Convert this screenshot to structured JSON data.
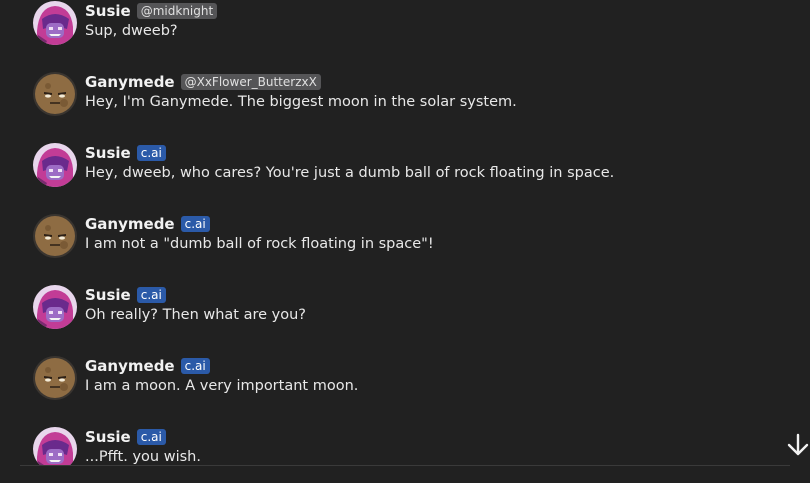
{
  "messages": [
    {
      "author": "Susie",
      "tag": "@midknight",
      "tag_type": "user",
      "text": "Sup, dweeb?",
      "avatar": "susie"
    },
    {
      "author": "Ganymede",
      "tag": "@XxFlower_ButterzxX",
      "tag_type": "user",
      "text": "Hey, I'm Ganymede. The biggest moon in the solar system.",
      "avatar": "ganymede"
    },
    {
      "author": "Susie",
      "tag": "c.ai",
      "tag_type": "cai",
      "text": "Hey, dweeb, who cares? You're just a dumb ball of rock floating in space.",
      "avatar": "susie"
    },
    {
      "author": "Ganymede",
      "tag": "c.ai",
      "tag_type": "cai",
      "text": "I am not a \"dumb ball of rock floating in space\"!",
      "avatar": "ganymede"
    },
    {
      "author": "Susie",
      "tag": "c.ai",
      "tag_type": "cai",
      "text": "Oh really? Then what are you?",
      "avatar": "susie"
    },
    {
      "author": "Ganymede",
      "tag": "c.ai",
      "tag_type": "cai",
      "text": "I am a moon. A very important moon.",
      "avatar": "ganymede"
    },
    {
      "author": "Susie",
      "tag": "c.ai",
      "tag_type": "cai",
      "text": "...Pfft. you wish.",
      "avatar": "susie"
    }
  ],
  "scroll_button": {
    "icon": "arrow-down-icon"
  },
  "colors": {
    "background": "#212121",
    "user_tag": "#555557",
    "cai_tag": "#2b5aa8"
  }
}
